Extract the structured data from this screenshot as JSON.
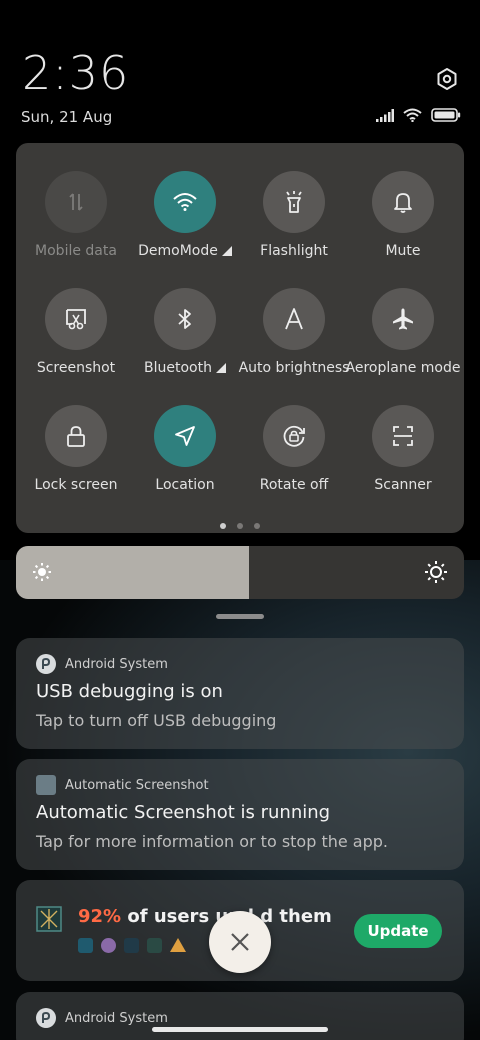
{
  "status": {
    "time": "2:36",
    "date": "Sun, 21 Aug"
  },
  "tiles": [
    {
      "label": "Mobile data",
      "icon": "mobile-data-icon",
      "state": "disabled"
    },
    {
      "label": "DemoMode",
      "icon": "wifi-icon",
      "state": "on",
      "has_more": true
    },
    {
      "label": "Flashlight",
      "icon": "flashlight-icon",
      "state": "off"
    },
    {
      "label": "Mute",
      "icon": "bell-icon",
      "state": "off"
    },
    {
      "label": "Screenshot",
      "icon": "screenshot-icon",
      "state": "off"
    },
    {
      "label": "Bluetooth",
      "icon": "bluetooth-icon",
      "state": "off",
      "has_more": true
    },
    {
      "label": "Auto brightness",
      "icon": "auto-brightness-icon",
      "state": "off"
    },
    {
      "label": "Aeroplane mode",
      "icon": "airplane-icon",
      "state": "off"
    },
    {
      "label": "Lock screen",
      "icon": "lock-icon",
      "state": "off"
    },
    {
      "label": "Location",
      "icon": "location-icon",
      "state": "on"
    },
    {
      "label": "Rotate off",
      "icon": "rotate-lock-icon",
      "state": "off"
    },
    {
      "label": "Scanner",
      "icon": "scanner-icon",
      "state": "off"
    }
  ],
  "pager": {
    "count": 3,
    "active": 0
  },
  "brightness": {
    "level": 0.52
  },
  "notifications": [
    {
      "app": "Android System",
      "title": "USB debugging is on",
      "body": "Tap to turn off USB debugging"
    },
    {
      "app": "Automatic Screenshot",
      "title": "Automatic Screenshot is running",
      "body": "Tap for more information or to stop the app."
    },
    {
      "percent": "92%",
      "text": " of users upd  d them",
      "button": "Update"
    },
    {
      "app": "Android System"
    }
  ],
  "colors": {
    "accent": "#2f807e",
    "update_green": "#1ea968",
    "percent_orange": "#ff6a45"
  }
}
